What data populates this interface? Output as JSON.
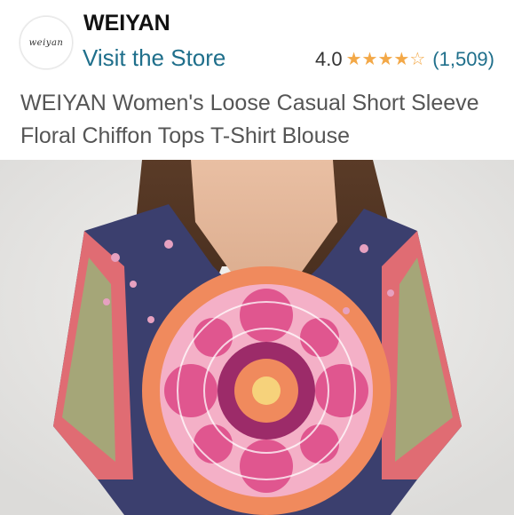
{
  "brand": {
    "logo_text": "weiyan",
    "name": "WEIYAN",
    "visit_store": "Visit the Store"
  },
  "rating": {
    "value": "4.0",
    "stars": 4,
    "max_stars": 5,
    "review_count": "(1,509)",
    "star_color": "#f3a847"
  },
  "product": {
    "title": "WEIYAN Women's Loose Casual Short Sleeve Floral Chiffon Tops T-Shirt Blouse",
    "image_icon": "product-photo"
  },
  "colors": {
    "link": "#1f6f8b",
    "title_text": "#555555",
    "navy": "#3b3f6e",
    "pink": "#e0568f",
    "coral": "#f08a5d"
  }
}
